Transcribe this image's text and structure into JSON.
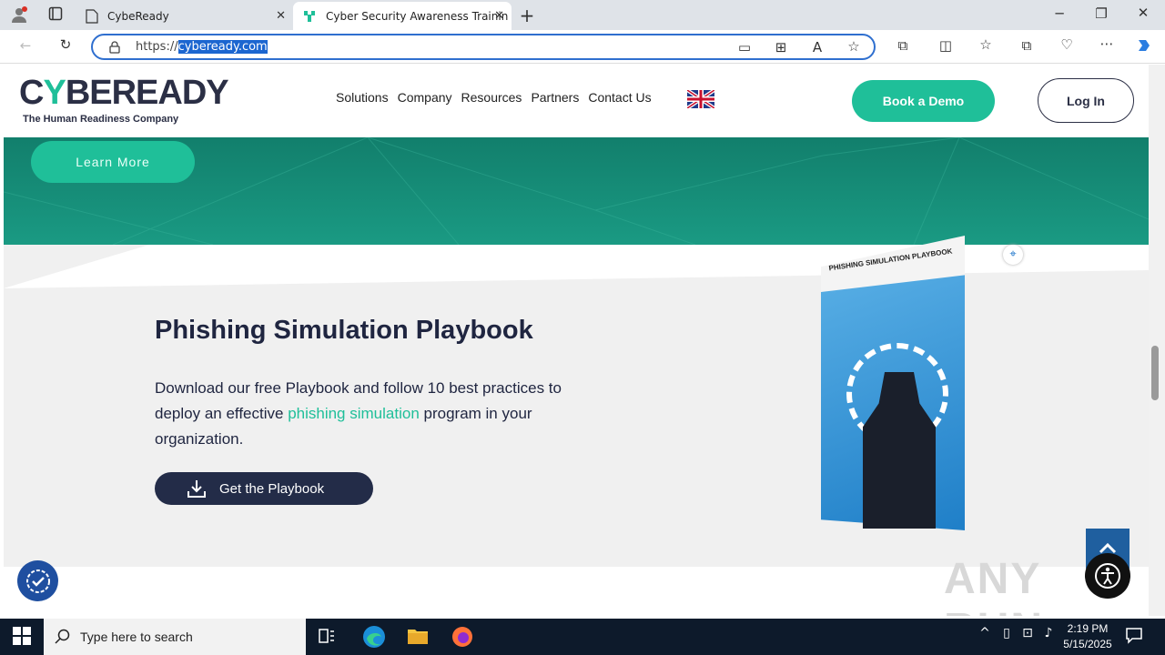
{
  "browser": {
    "tabs": [
      {
        "label": "CybeReady"
      },
      {
        "label": "Cyber Security Awareness Trainin"
      }
    ],
    "url_prefix": "https://",
    "url_selected": "cybeready.com"
  },
  "site": {
    "logo": {
      "text_a": "C",
      "text_accent": "Y",
      "text_b": "BEREADY",
      "tagline": "The Human Readiness Company"
    },
    "nav": [
      "Solutions",
      "Company",
      "Resources",
      "Partners",
      "Contact Us"
    ],
    "book_demo": "Book a Demo",
    "login": "Log In",
    "learn_more": "Learn More"
  },
  "section": {
    "title": "Phishing Simulation Playbook",
    "body_1": "Download our free Playbook and follow 10 best practices to deploy an effective ",
    "body_link": "phishing simulation",
    "body_2": " program in your organization.",
    "cta": "Get the Playbook",
    "book_cover_label": "PHISHING SIMULATION PLAYBOOK"
  },
  "watermark": "ANY RUN",
  "taskbar": {
    "search_placeholder": "Type here to search",
    "time": "2:19 PM",
    "date": "5/15/2025"
  },
  "colors": {
    "brand_green": "#1fbf99",
    "brand_navy": "#232c48",
    "selection": "#1c66d0"
  }
}
